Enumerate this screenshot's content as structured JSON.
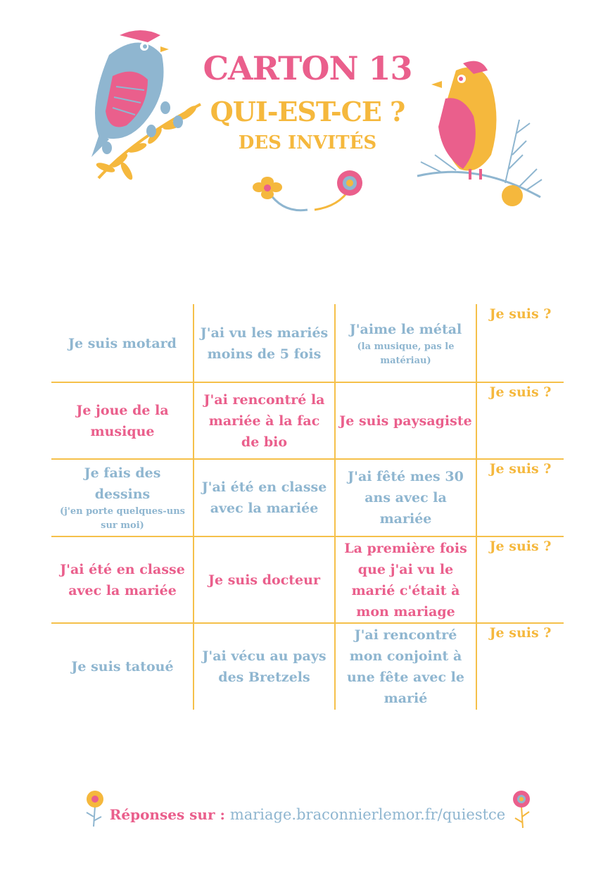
{
  "header": {
    "title": "CARTON 13",
    "subtitle": "QUI-EST-CE ?",
    "subsubtitle": "DES INVITÉS"
  },
  "colors": {
    "pink": "#ea5f8c",
    "gold": "#f5b83d",
    "blue": "#8fb6d0",
    "grid": "#f5c04a"
  },
  "icons": [
    "bird-blue-icon",
    "bird-gold-icon",
    "flower-icon",
    "branch-icon"
  ],
  "grid": {
    "answer_label": "Je suis ?",
    "rows": [
      {
        "color": "blue",
        "cells": [
          {
            "main": "Je suis motard",
            "small": ""
          },
          {
            "main": "J'ai vu les mariés moins de 5 fois",
            "small": ""
          },
          {
            "main": "J'aime le métal",
            "small": "(la musique, pas le matériau)"
          }
        ]
      },
      {
        "color": "pink",
        "cells": [
          {
            "main": "Je joue de la musique",
            "small": ""
          },
          {
            "main": "J'ai rencontré la mariée à la fac de bio",
            "small": ""
          },
          {
            "main": "Je suis paysagiste",
            "small": ""
          }
        ]
      },
      {
        "color": "blue",
        "cells": [
          {
            "main": "Je fais des dessins",
            "small": "(j'en porte quelques-uns sur moi)"
          },
          {
            "main": "J'ai été en classe avec la mariée",
            "small": ""
          },
          {
            "main": "J'ai fêté mes 30 ans avec la mariée",
            "small": ""
          }
        ]
      },
      {
        "color": "pink",
        "cells": [
          {
            "main": "J'ai été en classe avec la mariée",
            "small": ""
          },
          {
            "main": "Je suis docteur",
            "small": ""
          },
          {
            "main": "La première fois que j'ai vu le marié c'était à mon mariage",
            "small": ""
          }
        ]
      },
      {
        "color": "blue",
        "cells": [
          {
            "main": "Je suis tatoué",
            "small": ""
          },
          {
            "main": "J'ai vécu au pays des Bretzels",
            "small": ""
          },
          {
            "main": "J'ai rencontré mon conjoint à une fête avec le marié",
            "small": ""
          }
        ]
      }
    ]
  },
  "footer": {
    "label": "Réponses sur :",
    "url": "mariage.braconnierlemor.fr/quiestce"
  }
}
